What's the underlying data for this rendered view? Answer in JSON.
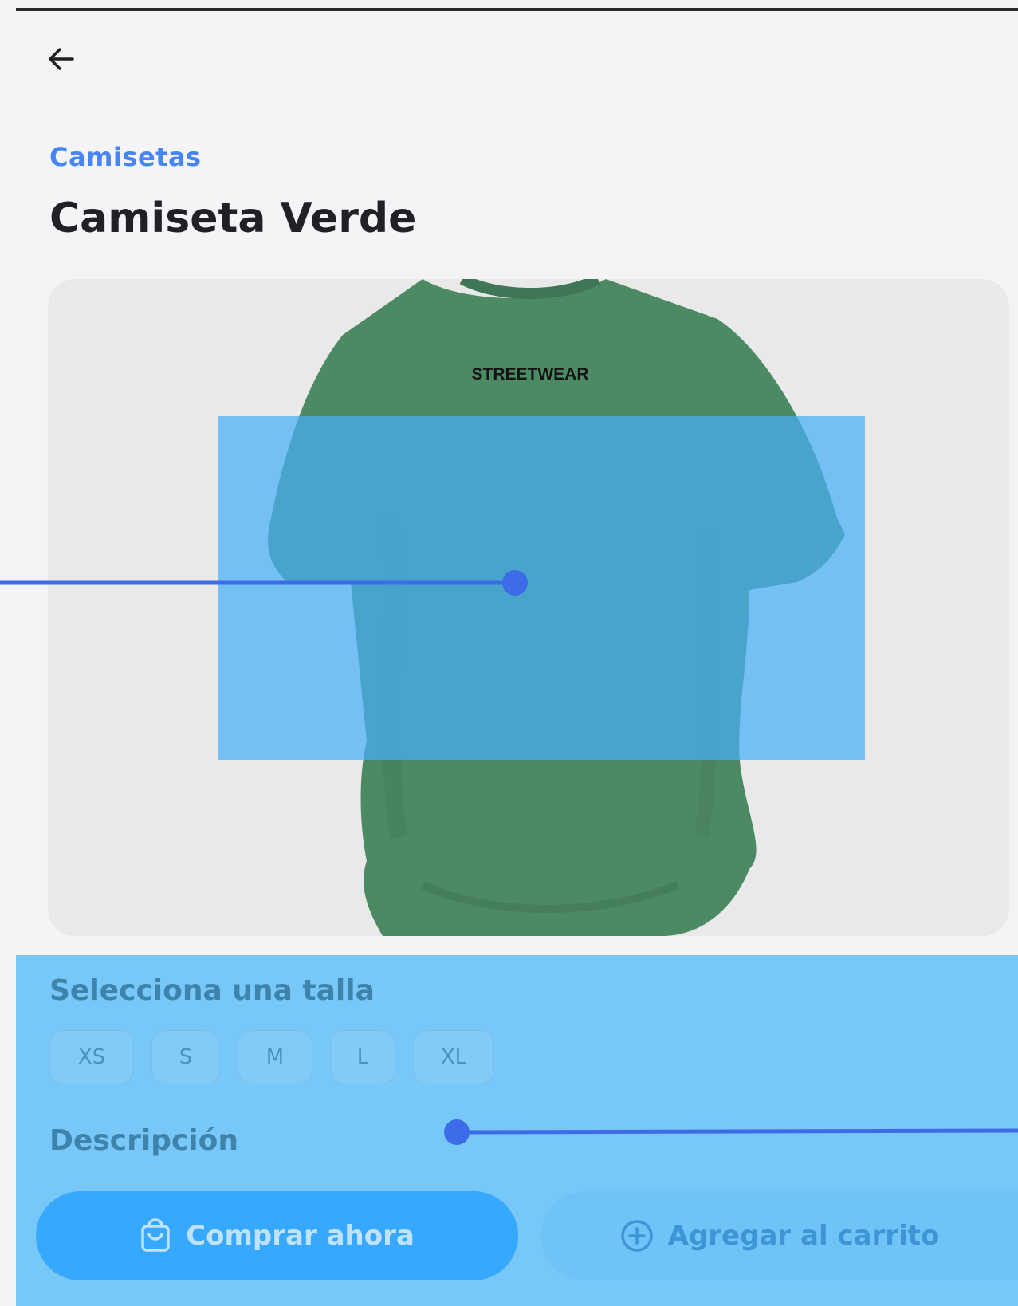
{
  "header": {
    "back_icon": "arrow-left-icon"
  },
  "product": {
    "category": "Camisetas",
    "name": "Camiseta Verde",
    "image_print_text": "STREETWEAR",
    "shirt_color": "#4c8a63"
  },
  "sizes": {
    "heading": "Selecciona una talla",
    "options": [
      "XS",
      "S",
      "M",
      "L",
      "XL"
    ]
  },
  "description": {
    "heading": "Descripción"
  },
  "actions": {
    "buy_label": "Comprar ahora",
    "buy_icon": "shopping-bag-icon",
    "cart_label": "Agregar al carrito",
    "cart_icon": "plus-circle-icon"
  },
  "colors": {
    "accent": "#4585f5",
    "overlay": "#47aff7",
    "connector": "#3d6ce8"
  }
}
